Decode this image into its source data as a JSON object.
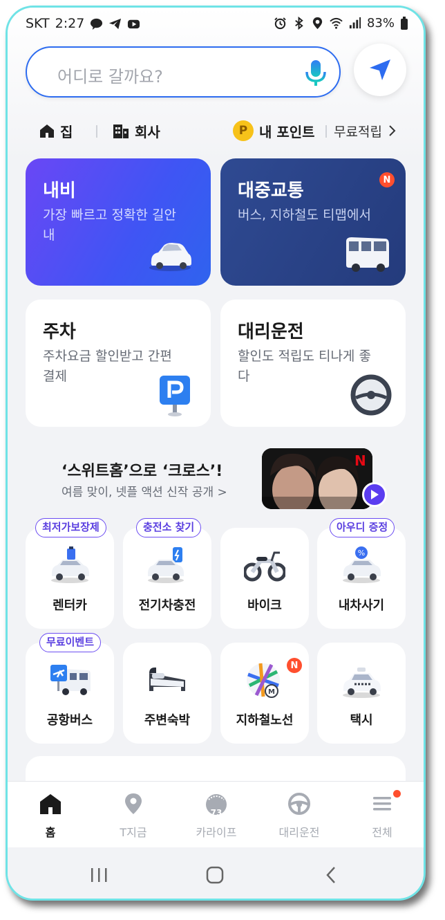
{
  "status_bar": {
    "carrier": "SKT",
    "time": "2:27",
    "battery": "83%"
  },
  "search": {
    "placeholder": "어디로 갈까요?"
  },
  "shortcuts": {
    "home": "집",
    "office": "회사",
    "points_icon": "P",
    "points": "내 포인트",
    "free_earn": "무료적립"
  },
  "cards": [
    {
      "title": "내비",
      "subtitle": "가장 빠르고 정확한 길안내"
    },
    {
      "title": "대중교통",
      "subtitle": "버스, 지하철도 티맵에서",
      "badge": "N"
    },
    {
      "title": "주차",
      "subtitle": "주차요금 할인받고 간편결제"
    },
    {
      "title": "대리운전",
      "subtitle": "할인도 적립도 티나게 좋다"
    }
  ],
  "promo": {
    "title": "‘스위트홈’으로 ‘크로스’!",
    "subtitle": "여름 맞이, 넷플 액션 신작 공개 >",
    "brand": "N"
  },
  "tiles": [
    {
      "label": "렌터카",
      "pill": "최저가보장제"
    },
    {
      "label": "전기차충전",
      "pill": "충전소 찾기"
    },
    {
      "label": "바이크"
    },
    {
      "label": "내차사기",
      "pill": "아우디 증정"
    },
    {
      "label": "공항버스",
      "pill": "무료이벤트"
    },
    {
      "label": "주변숙박"
    },
    {
      "label": "지하철노선",
      "badge": "N"
    },
    {
      "label": "택시"
    }
  ],
  "bottom_nav": [
    {
      "label": "홈",
      "active": true
    },
    {
      "label": "T지금"
    },
    {
      "label": "카라이프",
      "icon_text": "73"
    },
    {
      "label": "대리운전"
    },
    {
      "label": "전체"
    }
  ],
  "colors": {
    "accent": "#2d6cf0",
    "purple": "#6a47f5",
    "navy": "#243b7c",
    "badge": "#ff4f2e"
  }
}
